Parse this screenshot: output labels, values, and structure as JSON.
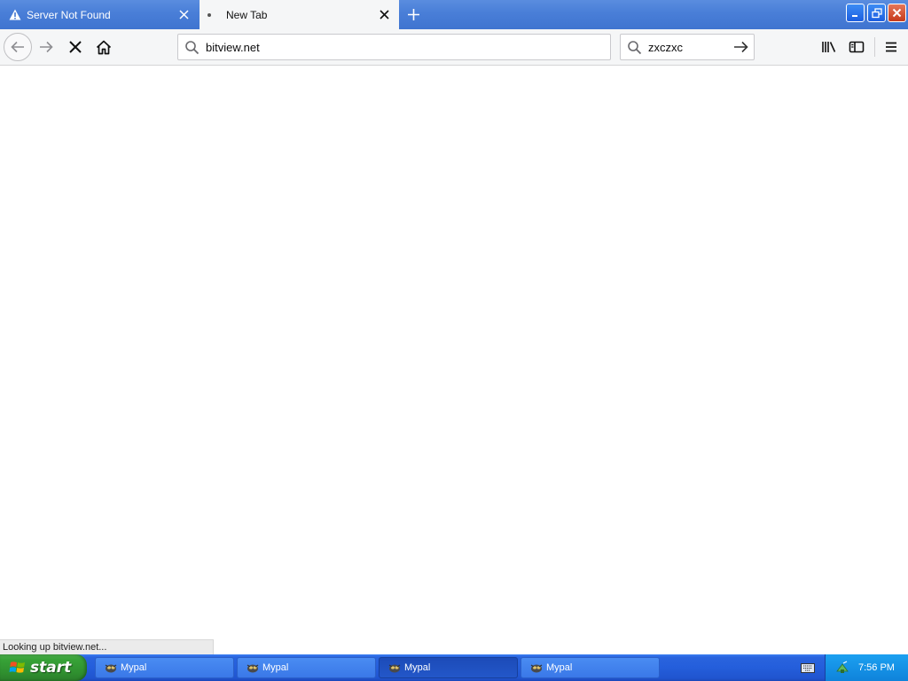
{
  "browser": {
    "tabs": [
      {
        "label": "Server Not Found",
        "icon": "warning-icon",
        "active": false
      },
      {
        "label": "New Tab",
        "icon": "loading-dot-icon",
        "active": true
      }
    ],
    "url": "bitview.net",
    "search_value": "zxczxc",
    "status_text": "Looking up bitview.net..."
  },
  "taskbar": {
    "start_label": "start",
    "windows": [
      {
        "label": "Mypal",
        "active": false
      },
      {
        "label": "Mypal",
        "active": false
      },
      {
        "label": "Mypal",
        "active": true
      },
      {
        "label": "Mypal",
        "active": false
      }
    ],
    "clock": "7:56 PM"
  },
  "colors": {
    "titlebar": "#4a7fd8",
    "toolbar": "#f5f6f7",
    "taskbar": "#245edb",
    "start_button": "#37a237",
    "tray": "#1592e6"
  }
}
